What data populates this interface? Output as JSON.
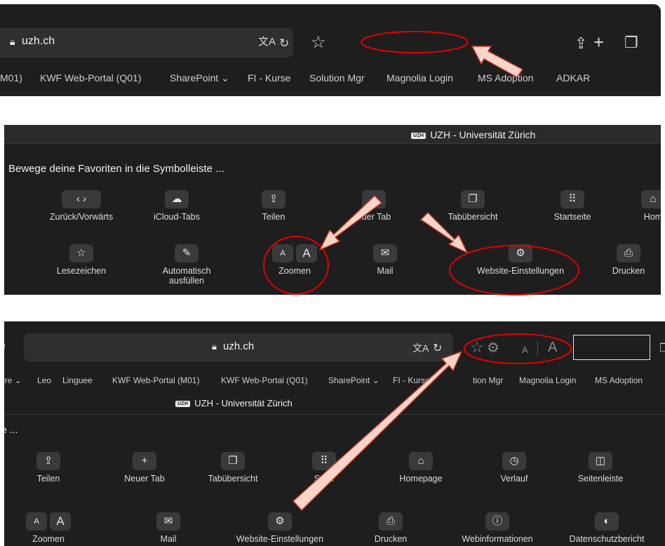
{
  "panel1": {
    "url": "uzh.ch",
    "bookmarks": [
      "M01)",
      "KWF Web-Portal (Q01)",
      "SharePoint ⌄",
      "FI - Kurse",
      "Solution Mgr",
      "Magnolia Login",
      "MS Adoption",
      "ADKAR"
    ]
  },
  "panel2": {
    "tab_title": "UZH - Universität Zürich",
    "uzh_badge": "UZH",
    "hint": "Bewege deine Favoriten in die Symbolleiste ...",
    "row1": [
      {
        "label": "Zurück/Vorwärts",
        "icon": "back-forward-icon",
        "glyph": "‹ ›"
      },
      {
        "label": "iCloud-Tabs",
        "icon": "cloud-icon",
        "glyph": "☁"
      },
      {
        "label": "Teilen",
        "icon": "share-icon",
        "glyph": "⇪"
      },
      {
        "label": "euer Tab",
        "icon": "plus-icon",
        "glyph": "+"
      },
      {
        "label": "Tabübersicht",
        "icon": "tab-overview-icon",
        "glyph": "❐"
      },
      {
        "label": "Startseite",
        "icon": "grid-icon",
        "glyph": "⠿"
      },
      {
        "label": "Hom",
        "icon": "home-icon",
        "glyph": "⌂"
      }
    ],
    "row2": [
      {
        "label": "Lesezeichen",
        "icon": "star-icon",
        "glyph": "☆"
      },
      {
        "label": "Automatisch ausfüllen",
        "icon": "autofill-icon",
        "glyph": "✎"
      },
      {
        "label": "Zoomen",
        "icon": "zoom-icon",
        "glyph_small": "A",
        "glyph_large": "A"
      },
      {
        "label": "Mail",
        "icon": "mail-icon",
        "glyph": "✉"
      },
      {
        "label": "Website-Einstellungen",
        "icon": "gear-icon",
        "glyph": "⚙"
      },
      {
        "label": "Drucken",
        "icon": "printer-icon",
        "glyph": "⎙"
      }
    ]
  },
  "panel3": {
    "url": "uzh.ch",
    "tab_title": "UZH - Universität Zürich",
    "uzh_badge": "UZH",
    "hint_partial": "e ...",
    "toolbar_zoom_small": "A",
    "toolbar_zoom_large": "A",
    "bookmarks": [
      "ere ⌄",
      "Leo",
      "Linguee",
      "KWF Web-Portal (M01)",
      "KWF Web-Portal (Q01)",
      "SharePoint ⌄",
      "FI - Kurse",
      "tion Mgr",
      "Magnolia Login",
      "MS Adoption"
    ],
    "row1": [
      {
        "label": "Teilen",
        "icon": "share-icon",
        "glyph": "⇪"
      },
      {
        "label": "Neuer Tab",
        "icon": "plus-icon",
        "glyph": "+"
      },
      {
        "label": "Tabübersicht",
        "icon": "tab-overview-icon",
        "glyph": "❐"
      },
      {
        "label": "St ite",
        "icon": "grid-icon",
        "glyph": "⠿"
      },
      {
        "label": "Homepage",
        "icon": "home-icon",
        "glyph": "⌂"
      },
      {
        "label": "Verlauf",
        "icon": "clock-icon",
        "glyph": "◷"
      },
      {
        "label": "Seitenleiste",
        "icon": "sidebar-icon",
        "glyph": "◫"
      }
    ],
    "row2": [
      {
        "label": "Zoomen",
        "icon": "zoom-icon",
        "glyph_small": "A",
        "glyph_large": "A"
      },
      {
        "label": "Mail",
        "icon": "mail-icon",
        "glyph": "✉"
      },
      {
        "label": "Website-Einstellungen",
        "icon": "gear-icon",
        "glyph": "⚙"
      },
      {
        "label": "Drucken",
        "icon": "printer-icon",
        "glyph": "⎙"
      },
      {
        "label": "Webinformationen",
        "icon": "info-icon",
        "glyph": "ⓘ"
      },
      {
        "label": "Datenschutzbericht",
        "icon": "shield-icon",
        "glyph": "◐"
      }
    ]
  },
  "colors": {
    "panel_bg": "#1e1e1f",
    "annotation": "#e00000",
    "arrow_fill": "#f9d4c8",
    "arrow_stroke": "#c0392b"
  }
}
